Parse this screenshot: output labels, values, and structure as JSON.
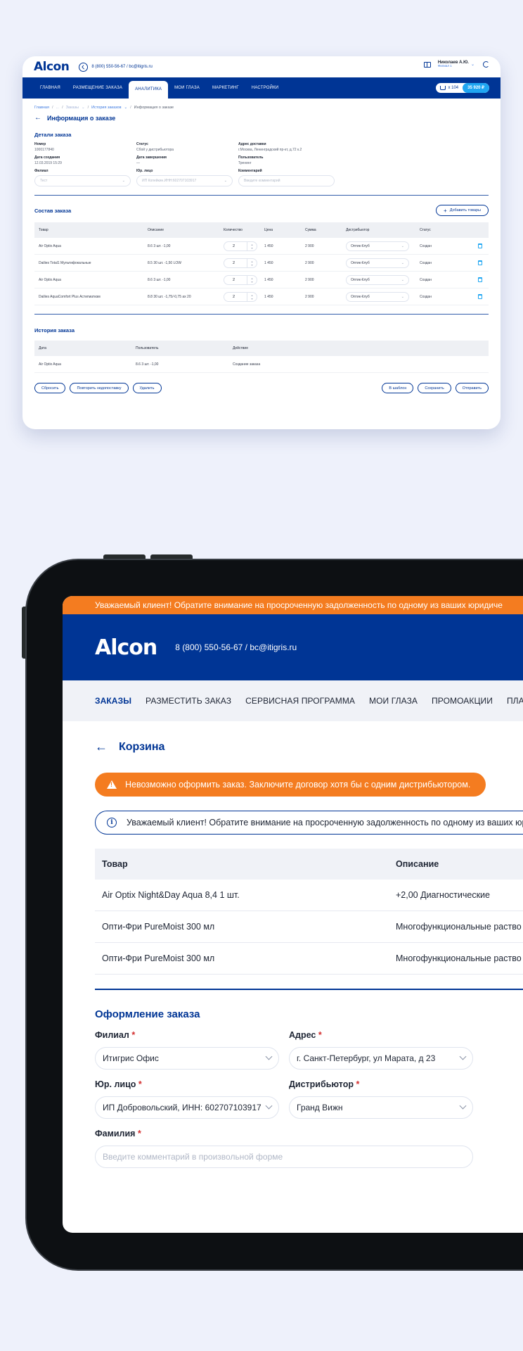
{
  "card": {
    "logo": "Alcon",
    "phone": "8 (800) 550-56-67 / bc@itigris.ru",
    "user_name": "Николаев А.Ю.",
    "user_sub": "Филиал 1",
    "nav": [
      "Главная",
      "Размещение заказа",
      "Аналитика",
      "Мои глаза",
      "Маркетинг",
      "Настройки"
    ],
    "cart_count": "x 104",
    "cart_sum": "35 920 ₽",
    "breadcrumbs": [
      "Главная",
      "...",
      "Заказы",
      "История заказов",
      "Информация о заказе"
    ],
    "title": "Информация о заказе",
    "details_title": "Детали заказа",
    "details": {
      "number_label": "Номер",
      "number": "1000177840",
      "status_label": "Статус",
      "status": "Сбой у дистрибьютора",
      "address_label": "Адрес доставки",
      "address": "г.Москва, Ленинградский пр-кт, д.72 к.2",
      "created_label": "Дата создания",
      "created": "12.03.2019 15:29",
      "completed_label": "Дата завершения",
      "completed": "—",
      "user_label": "Пользователь",
      "user": "Тренинг"
    },
    "fields": {
      "branch_label": "Филиал",
      "branch": "Тест",
      "entity_label": "Юр. лицо",
      "entity": "ИП Копейкин.ИНН:602707103917",
      "comment_label": "Комментарий",
      "comment_placeholder": "Введите комментарий"
    },
    "composition_title": "Состав заказа",
    "add_goods": "Добавить товары",
    "columns": [
      "Товар",
      "Описание",
      "Количество",
      "Цена",
      "Сумма",
      "Дистрибьютор",
      "Статус"
    ],
    "rows": [
      {
        "product": "Air Optix Aqua",
        "desc": "8.6 3 шт. -1,00",
        "qty": "2",
        "price": "1 450",
        "sum": "2 900",
        "dist": "Оптик-Клуб",
        "status": "Создан"
      },
      {
        "product": "Dailies Total1 Мультифокальные",
        "desc": "8.5 30 шт. -1,50 LOW",
        "qty": "2",
        "price": "1 450",
        "sum": "2 900",
        "dist": "Оптик-Клуб",
        "status": "Создан"
      },
      {
        "product": "Air Optix Aqua",
        "desc": "8.6 3 шт. -1,00",
        "qty": "2",
        "price": "1 450",
        "sum": "2 900",
        "dist": "Оптик-Клуб",
        "status": "Создан"
      },
      {
        "product": "Dailies AquaComfort Plus Астигматизм",
        "desc": "8.8 30 шт. -1,75/-0,75 ax 20",
        "qty": "2",
        "price": "1 450",
        "sum": "2 900",
        "dist": "Оптик-Клуб",
        "status": "Создан"
      }
    ],
    "history_title": "История заказа",
    "history_columns": [
      "Дата",
      "Пользователь",
      "Действие"
    ],
    "history_rows": [
      {
        "date": "Air Optix Aqua",
        "user": "8.6 3 шт. -1,00",
        "action": "Создание заказа"
      }
    ],
    "buttons_left": [
      "Сбросить",
      "Повторить недопоставку",
      "Удалить"
    ],
    "buttons_right": [
      "В шаблон",
      "Сохранить",
      "Отправить"
    ]
  },
  "tablet": {
    "alert": "Уважаемый клиент! Обратите внимание на просроченную задолженность по одному из ваших юридиче",
    "logo": "Alcon",
    "phone": "8 (800) 550-56-67 / bc@itigris.ru",
    "nav": [
      "Заказы",
      "Разместить заказ",
      "Сервисная программа",
      "Мои глаза",
      "Промоакции",
      "План зака"
    ],
    "title": "Корзина",
    "warning": "Невозможно оформить заказ. Заключите договор хотя бы с одним дистрибьютором.",
    "info": "Уважаемый клиент! Обратите внимание на просроченную задолженность по одному из ваших юрид",
    "columns": [
      "Товар",
      "Описание"
    ],
    "rows": [
      {
        "product": "Air Optix Night&Day Aqua 8,4 1 шт.",
        "desc": "+2,00 Диагностические"
      },
      {
        "product": "Опти-Фри PureMoist 300 мл",
        "desc": "Многофункциональные раство"
      },
      {
        "product": "Опти-Фри PureMoist 300 мл",
        "desc": "Многофункциональные раство"
      }
    ],
    "form_title": "Оформление заказа",
    "form": {
      "branch_label": "Филиал",
      "branch": "Итигрис Офис",
      "address_label": "Адрес",
      "address": "г. Санкт-Петербург, ул Марата, д 23",
      "entity_label": "Юр. лицо",
      "entity": "ИП Добровольский, ИНН: 602707103917",
      "distributor_label": "Дистрибьютор",
      "distributor": "Гранд Вижн",
      "surname_label": "Фамилия",
      "surname_placeholder": "Введите комментарий в произвольной форме"
    },
    "required_mark": "*"
  }
}
